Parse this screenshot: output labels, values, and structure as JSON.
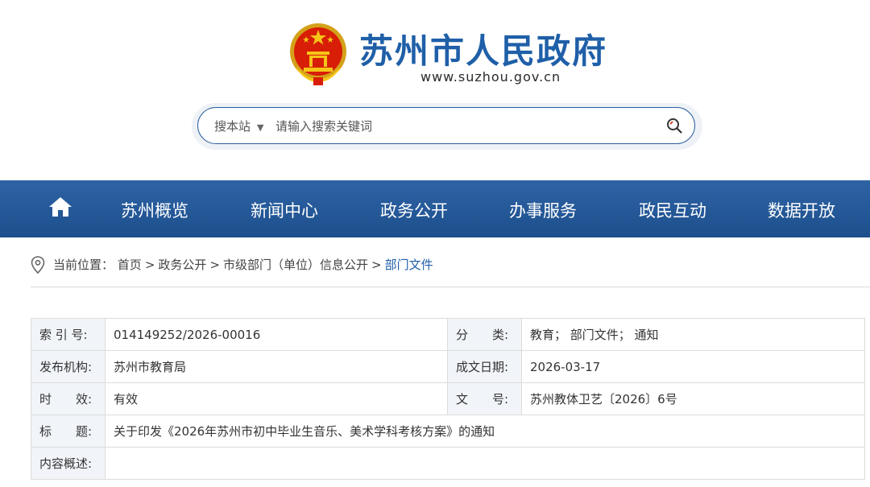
{
  "site": {
    "title": "苏州市人民政府",
    "url": "www.suzhou.gov.cn"
  },
  "search": {
    "scope": "搜本站",
    "placeholder": "请输入搜索关键词"
  },
  "nav": {
    "items": [
      "苏州概览",
      "新闻中心",
      "政务公开",
      "办事服务",
      "政民互动",
      "数据开放"
    ]
  },
  "breadcrumb": {
    "prefix": "当前位置：",
    "items": [
      "首页",
      "政务公开",
      "市级部门（单位）信息公开",
      "部门文件"
    ],
    "separator": ">"
  },
  "info": {
    "index_no_label": "索 引 号:",
    "index_no": "014149252/2026-00016",
    "category_label": "分　　类:",
    "category": "教育； 部门文件； 通知",
    "publisher_label": "发布机构:",
    "publisher": "苏州市教育局",
    "date_label": "成文日期:",
    "date": "2026-03-17",
    "validity_label": "时　　效:",
    "validity": "有效",
    "doc_no_label": "文　　号:",
    "doc_no": "苏州教体卫艺〔2026〕6号",
    "title_label": "标　　题:",
    "title": "关于印发《2026年苏州市初中毕业生音乐、美术学科考核方案》的通知",
    "summary_label": "内容概述:",
    "summary": ""
  },
  "colors": {
    "brand_blue": "#1f5fa8",
    "nav_bg": "#2e63a5",
    "label_bg": "#f1f4f8"
  }
}
